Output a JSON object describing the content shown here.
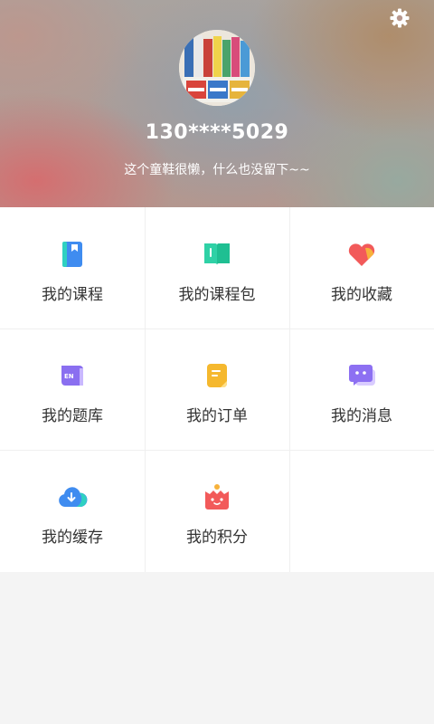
{
  "profile": {
    "phone": "130****5029",
    "bio": "这个童鞋很懒，什么也没留下~~",
    "avatar_icon": "avatar-books-photo"
  },
  "header": {
    "settings_icon": "gear-icon"
  },
  "menu": {
    "items": [
      {
        "label": "我的课程",
        "icon": "book-icon",
        "color": "#3f8cf0"
      },
      {
        "label": "我的课程包",
        "icon": "open-book-icon",
        "color": "#2fd1a6"
      },
      {
        "label": "我的收藏",
        "icon": "heart-icon",
        "color": "#f25a5a"
      },
      {
        "label": "我的题库",
        "icon": "en-book-icon",
        "color": "#8a6ff0"
      },
      {
        "label": "我的订单",
        "icon": "note-icon",
        "color": "#f5b82e"
      },
      {
        "label": "我的消息",
        "icon": "chat-icon",
        "color": "#8d70f2"
      },
      {
        "label": "我的缓存",
        "icon": "cloud-download-icon",
        "color": "#3f8cf0"
      },
      {
        "label": "我的积分",
        "icon": "gift-box-icon",
        "color": "#f25a5a"
      }
    ]
  }
}
